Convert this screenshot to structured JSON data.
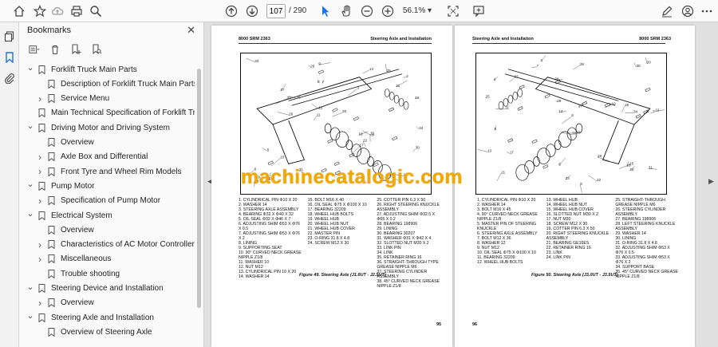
{
  "toolbar": {
    "page_current": "107",
    "page_total": "/ 290",
    "zoom": "56.1%"
  },
  "bookmarks": {
    "title": "Bookmarks",
    "items": [
      {
        "label": "Forklift Truck Main Parts",
        "level": 0,
        "expanded": true
      },
      {
        "label": "Description of Forklift Truck Main Parts",
        "level": 1,
        "expanded": null
      },
      {
        "label": "Service Menu",
        "level": 1,
        "expanded": false
      },
      {
        "label": "Main Technical Specification of Forklift Truck",
        "level": 0,
        "expanded": null
      },
      {
        "label": "Driving Motor and Driving System",
        "level": 0,
        "expanded": true
      },
      {
        "label": "Overview",
        "level": 1,
        "expanded": null
      },
      {
        "label": "Axle Box and Differential",
        "level": 1,
        "expanded": false
      },
      {
        "label": "Front Tyre and Wheel Rim Models",
        "level": 1,
        "expanded": false
      },
      {
        "label": "Pump Motor",
        "level": 0,
        "expanded": true
      },
      {
        "label": "Specification of Pump Motor",
        "level": 1,
        "expanded": false
      },
      {
        "label": "Electrical System",
        "level": 0,
        "expanded": true
      },
      {
        "label": "Overview",
        "level": 1,
        "expanded": null
      },
      {
        "label": "Characteristics of AC Motor Controller",
        "level": 1,
        "expanded": false
      },
      {
        "label": "Miscellaneous",
        "level": 1,
        "expanded": false
      },
      {
        "label": "Trouble shooting",
        "level": 1,
        "expanded": null
      },
      {
        "label": "Steering Device and Installation",
        "level": 0,
        "expanded": true
      },
      {
        "label": "Overview",
        "level": 1,
        "expanded": false
      },
      {
        "label": "Steering Axle and Installation",
        "level": 0,
        "expanded": true
      },
      {
        "label": "Overview of Steering Axle",
        "level": 1,
        "expanded": null
      }
    ]
  },
  "left_page": {
    "header_left": "8000 SRM 2363",
    "header_right": "Steering Axle and Installation",
    "legend_col1": "1. CYLINDRICAL PIN Φ10 X 20\n2. WASHER 14\n3. STEERING AXLE ASSEMBLY\n4. BEARING Φ32 X Φ40 X 32\n5. OIL SEAL Φ32 X Φ46 X 7\n6. ADJUSTING SHIM Φ53 X Φ76 X 0.5\n7. ADJUSTING SHIM Φ53 X Φ76 X 2\n8. LINING\n9. SUPPORTING SEAT\n10. 90° CURVED NECK GREASE NIPPLE Z1/8\n11. WASHER 10\n12. NUT M12\n13. CYLINDRICAL PIN 10 X 20\n14. WASHER 14",
    "legend_col2": "15. BOLT M16 X 40\n16. OIL SEAL Φ75 X Φ100 X 10\n17. BEARING 32209\n18. WHEEL HUB BOLTS\n19. WHEEL HUB\n20. WHEEL HUB NUT\n21. WHEEL HUB COVER\n22. MASTER PIN\n23. O-RING 31.8 X 4.8\n24. SCREW M12 X 30",
    "legend_col3": "25. COTTER PIN 6.3 X 50\n26. RIGHT STEERING KNUCKLE ASSEMBLY\n27. ADJUSTING SHIM Φ32.5 X Φ65 X 0.2\n28. BEARING 198906\n29. LINING\n30. BEARING 30207\n31. WASHER Φ31 X Φ42 X 4\n32. SLOTTED NUT M30 X 2\n33. LINK PIN\n34. LINK\n35. RETAINER RING 16\n36. STRAIGHT-THROUGH TYPE GREASE NIPPLE M6\n37. STEERING CYLINDER ASSEMBLY\n38. 45° CURVED NECK GREASE NIPPLE Z1/8",
    "caption": "Figure 49. Steering Axle (J1.6UT - J2.5UT)",
    "page_number": "95"
  },
  "right_page": {
    "header_left": "Steering Axle and Installation",
    "header_right": "8000 SRM 2363",
    "legend_col1": "1. CYLINDRICAL PIN Φ10 X 20\n2. WASHER 14\n3. BOLT M16 X 45\n4. 90° CURVED NECK GREASE NIPPLE Z1/8\n5. MASTER PIN OF STEERING KNUCKLE\n6. STEERING AXLE ASSEMBLY\n7. BOLT M12 X 36\n8. WASHER 12\n9. NUT M12\n10. OIL SEAL Φ75 X Φ100 X 10\n11. BEARING 32209\n12. WHEEL HUB BOLTS",
    "legend_col2": "13. WHEEL HUB\n14. WHEEL HUB NUT\n15. WHEEL HUB COVER\n16. SLOTTED NUT M30 X 2\n17. NUT M30\n18. SCREW M12 X 30\n19. COTTER PIN 6.3 X 50\n20. RIGHT STEERING KNUCKLE ASSEMBLY\n21. BEARING GE16ES\n22. RETAINER RING 16\n23. LINK\n24. LINK PIN",
    "legend_col3": "25. STRAIGHT-THROUGH GREASE NIPPLE M6\n26. STEERING CYLINDER ASSEMBLY\n27. BEARING 198906\n28. LEFT STEERING KNUCKLE ASSEMBLY\n29. WASHER 14\n30. LINING\n31. O-RING 31.8 X 4.8\n32. ADJUSTING SHIM Φ53 X Φ76 X 0.5\n33. ADJUSTING SHIM Φ53 X Φ76 X 2\n34. SUPPORT BASE\n35. 45° CURVED NECK GREASE NIPPLE Z1/8",
    "caption": "Figure 50. Steering Axle (J3.0UT - J3.5UT)",
    "page_number": "96"
  },
  "watermark": "machinecatalogic.com",
  "colors": {
    "accent": "#1a73e8",
    "watermark": "#f2a900"
  }
}
